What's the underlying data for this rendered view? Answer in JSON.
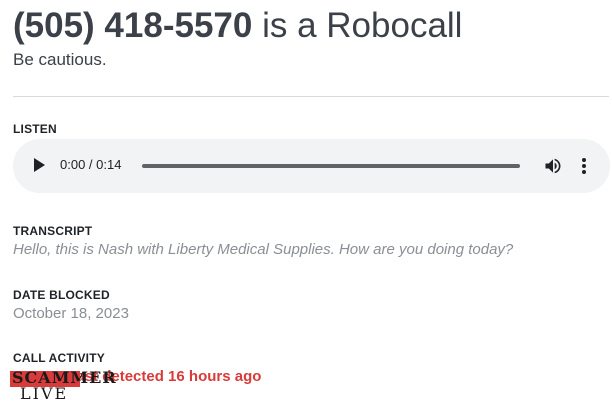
{
  "header": {
    "phone_number": "(505) 418-5570",
    "verdict": "is a Robocall",
    "subtitle": "Be cautious."
  },
  "listen": {
    "label": "LISTEN",
    "player": {
      "time": "0:00 / 0:14",
      "progress": 0
    }
  },
  "transcript": {
    "label": "TRANSCRIPT",
    "text": "Hello, this is Nash with Liberty Medical Supplies. How are you doing today?"
  },
  "date_blocked": {
    "label": "DATE BLOCKED",
    "value": "October 18, 2023"
  },
  "call_activity": {
    "label": "CALL ACTIVITY",
    "status": "Scam Last detected 16 hours ago"
  },
  "brand": {
    "top": "SCAMMER",
    "bottom": "LIVE"
  },
  "colors": {
    "accent_red": "#d93a3a",
    "muted_text": "#8a8f96",
    "player_bg": "#f1f3f4"
  },
  "icons": {
    "play": "play-icon",
    "volume": "volume-icon",
    "more": "more-vertical-icon"
  }
}
